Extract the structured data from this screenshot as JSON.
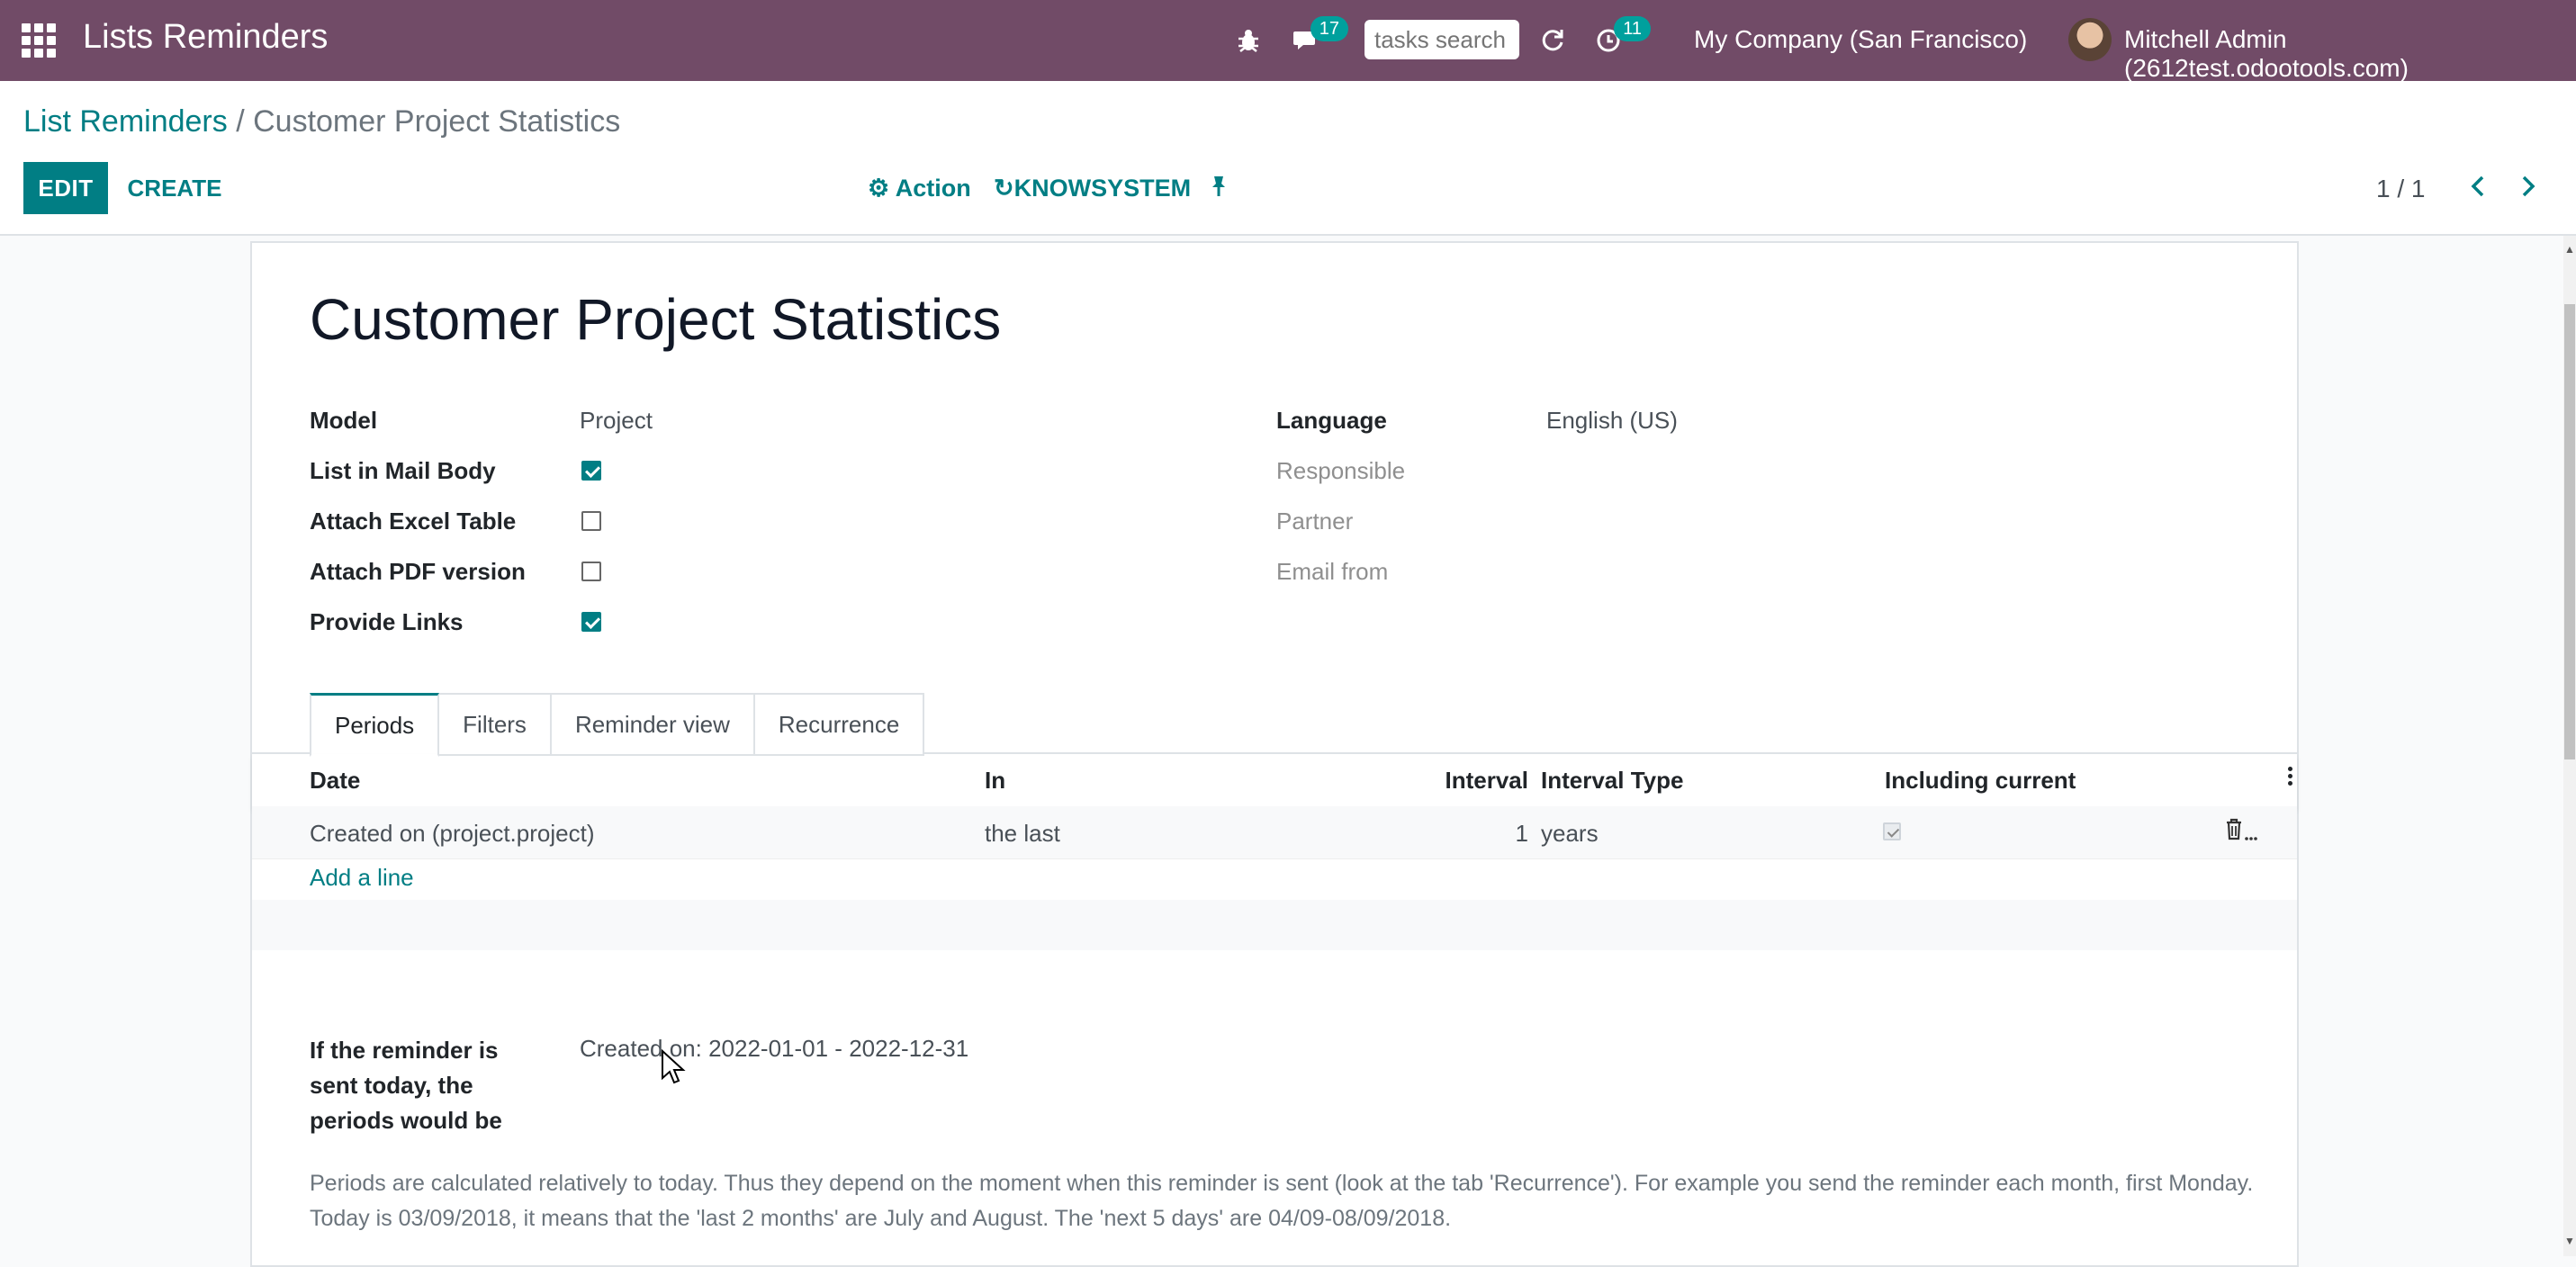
{
  "navbar": {
    "app_title": "Lists Reminders",
    "messages_count": "17",
    "search_placeholder": "tasks search",
    "activities_count": "11",
    "company": "My Company (San Francisco)",
    "user": "Mitchell Admin (2612test.odootools.com)"
  },
  "breadcrumb": {
    "parent": "List Reminders",
    "separator": "/",
    "current": "Customer Project Statistics"
  },
  "toolbar": {
    "edit": "EDIT",
    "create": "CREATE",
    "action": "Action",
    "knowsystem": "KNOWSYSTEM",
    "pager": "1 / 1"
  },
  "record": {
    "title": "Customer Project Statistics",
    "left_fields": [
      {
        "label": "Model",
        "value": "Project"
      },
      {
        "label": "List in Mail Body",
        "checked": true
      },
      {
        "label": "Attach Excel Table",
        "checked": false
      },
      {
        "label": "Attach PDF version",
        "checked": false
      },
      {
        "label": "Provide Links",
        "checked": true
      }
    ],
    "right_fields": [
      {
        "label": "Language",
        "value": "English (US)"
      },
      {
        "label": "Responsible",
        "value": ""
      },
      {
        "label": "Partner",
        "value": ""
      },
      {
        "label": "Email from",
        "value": ""
      }
    ]
  },
  "tabs": [
    "Periods",
    "Filters",
    "Reminder view",
    "Recurrence"
  ],
  "active_tab": "Periods",
  "table": {
    "headers": [
      "Date",
      "In",
      "Interval",
      "Interval Type",
      "Including current"
    ],
    "rows": [
      {
        "date": "Created on (project.project)",
        "in": "the last",
        "interval": "1",
        "interval_type": "years",
        "including_current": true
      }
    ],
    "add_line": "Add a line"
  },
  "preview": {
    "label": "If the reminder is sent today, the periods would be",
    "value": "Created on: 2022-01-01 - 2022-12-31"
  },
  "note": "Periods are calculated relatively to today. Thus they depend on the moment when this reminder is sent (look at the tab 'Recurrence'). For example you send the reminder each month, first Monday. Today is 03/09/2018, it means that the 'last 2 months' are July and August. The 'next 5 days' are 04/09-08/09/2018.",
  "colors": {
    "brand": "#714b67",
    "accent": "#017e84",
    "badge": "#00a09d"
  }
}
